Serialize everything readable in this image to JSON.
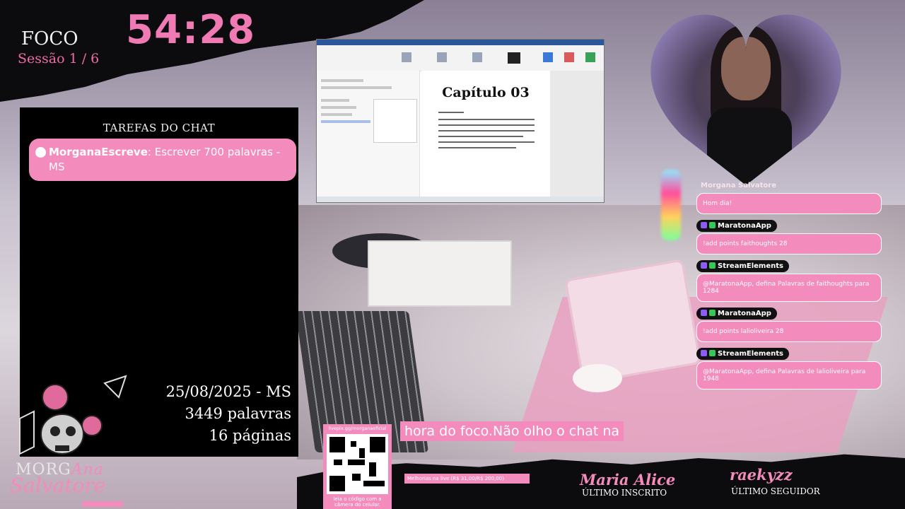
{
  "focus": {
    "label": "FOCO",
    "session": "Sessão 1 / 6",
    "timer": "54:28"
  },
  "tasks": {
    "title": "TAREFAS DO CHAT",
    "items": [
      {
        "user": "MorganaEscreve",
        "text": ": Escrever 700 palavras - MS"
      }
    ]
  },
  "stats": {
    "date": "25/08/2025 - MS",
    "words": "3449 palavras",
    "pages": "16 páginas"
  },
  "document": {
    "title": "Capítulo 03"
  },
  "chat": {
    "header": "Morgana Salvatore",
    "messages": [
      {
        "user": "",
        "text": "Hom dia!"
      },
      {
        "user": "MaratonaApp",
        "text": "!add points faithoughts 28"
      },
      {
        "user": "StreamElements",
        "text": "@MaratonaApp, defina Palavras de faithoughts para 1284"
      },
      {
        "user": "MaratonaApp",
        "text": "!add points lalioliveira 28"
      },
      {
        "user": "StreamElements",
        "text": "@MaratonaApp, defina Palavras de lalioliveira para 1948"
      }
    ]
  },
  "ticker": {
    "text": "hora do foco.Não olho o chat na"
  },
  "qr": {
    "url": "livepix.gg/morganaoficial",
    "caption": "leia o código com a câmera do celular."
  },
  "goal": {
    "text": "Melhorias na live (R$ 31,00/R$ 200,00)"
  },
  "last_subscriber": {
    "name": "Maria Alice",
    "label": "ÚLTIMO INSCRITO"
  },
  "last_follower": {
    "name": "raekyzz",
    "label": "ÚLTIMO SEGUIDOR"
  },
  "logo": {
    "line1": "MORG",
    "line1b": "Ana",
    "line2": "Salvatore"
  },
  "colors": {
    "accent": "#f38bbd",
    "timer": "#f07bb4",
    "panel": "#000000"
  }
}
